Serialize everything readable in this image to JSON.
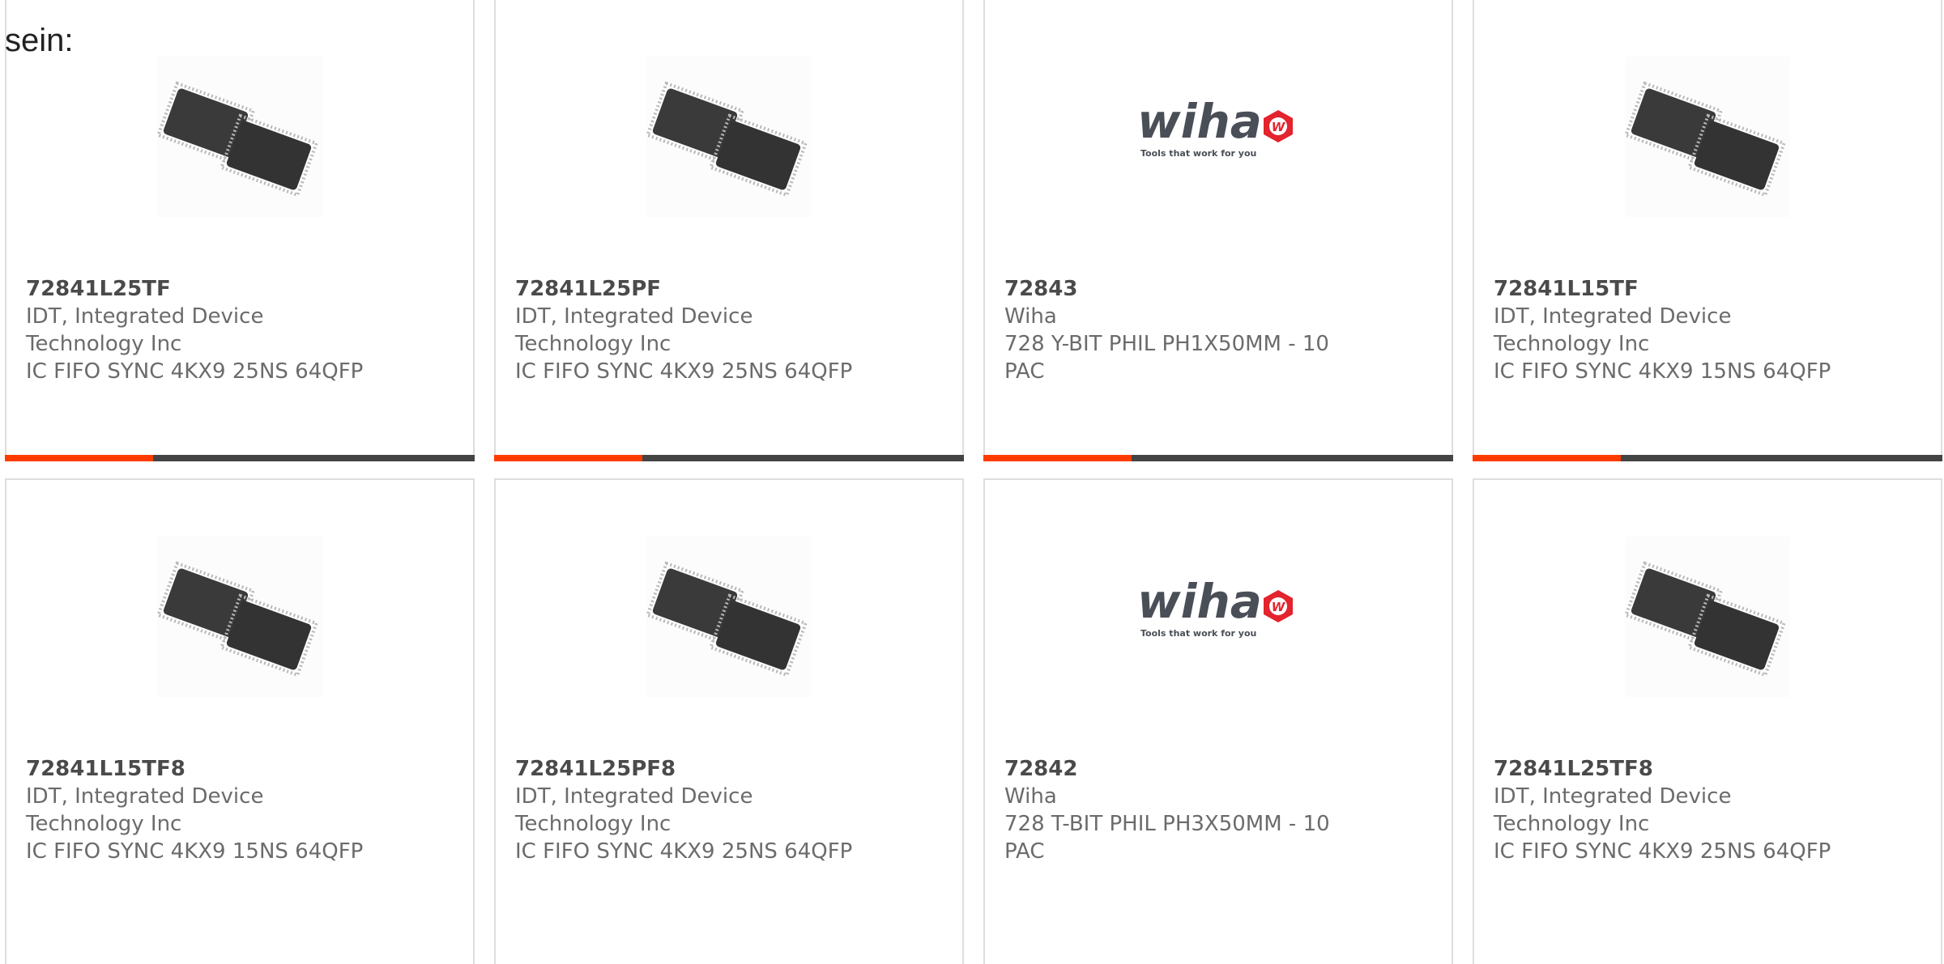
{
  "lead_text": "sein:",
  "colors": {
    "accent": "#ff3c00",
    "bar": "#444444",
    "text": "#6b6b6b",
    "wiha_red": "#e3232d"
  },
  "products": [
    {
      "part": "72843",
      "manufacturer": "Wiha",
      "description_line1": "728 Y-BIT PHIL PH1X50MM - 10",
      "description_line2": "PAC",
      "image": "wiha-logo"
    }
  ],
  "row1": [
    {
      "part": "72841L25TF",
      "line1": "IDT, Integrated Device",
      "line2": "Technology Inc",
      "line3": "IC FIFO SYNC 4KX9 25NS 64QFP",
      "image": "chip-photo"
    },
    {
      "part": "72841L25PF",
      "line1": "IDT, Integrated Device",
      "line2": "Technology Inc",
      "line3": "IC FIFO SYNC 4KX9 25NS 64QFP",
      "image": "chip-photo"
    },
    {
      "part": "72843",
      "line1": "Wiha",
      "line2": "728 Y-BIT PHIL PH1X50MM - 10",
      "line3": "PAC",
      "image": "wiha-logo"
    },
    {
      "part": "72841L15TF",
      "line1": "IDT, Integrated Device",
      "line2": "Technology Inc",
      "line3": "IC FIFO SYNC 4KX9 15NS 64QFP",
      "image": "chip-photo"
    }
  ],
  "row2": [
    {
      "part": "72841L15TF8",
      "line1": "IDT, Integrated Device",
      "line2": "Technology Inc",
      "line3": "IC FIFO SYNC 4KX9 15NS 64QFP",
      "image": "chip-photo"
    },
    {
      "part": "72841L25PF8",
      "line1": "IDT, Integrated Device",
      "line2": "Technology Inc",
      "line3": "IC FIFO SYNC 4KX9 25NS 64QFP",
      "image": "chip-photo"
    },
    {
      "part": "72842",
      "line1": "Wiha",
      "line2": "728 T-BIT PHIL PH3X50MM - 10",
      "line3": "PAC",
      "image": "wiha-logo"
    },
    {
      "part": "72841L25TF8",
      "line1": "IDT, Integrated Device",
      "line2": "Technology Inc",
      "line3": "IC FIFO SYNC 4KX9 25NS 64QFP",
      "image": "chip-photo"
    }
  ],
  "logo": {
    "wordmark": "wiha",
    "tagline": "Tools that work for you",
    "badge": "W"
  }
}
